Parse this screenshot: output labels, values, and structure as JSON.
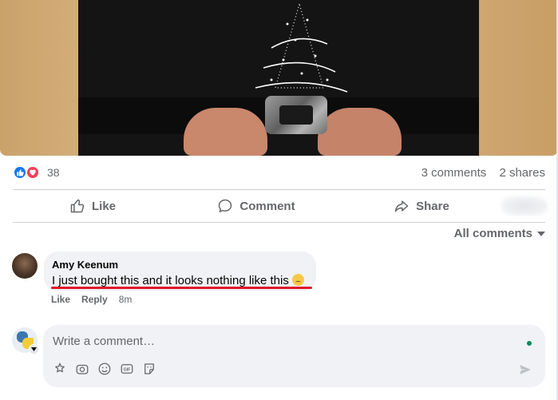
{
  "post": {
    "reaction_count": "38",
    "comments_count": "3 comments",
    "shares_count": "2 shares"
  },
  "actions": {
    "like": "Like",
    "comment": "Comment",
    "share": "Share"
  },
  "filter": {
    "label": "All comments"
  },
  "comments": [
    {
      "author": "Amy Keenum",
      "text": "I just bought this and it looks nothing like this",
      "emoji": "disappointed-face",
      "like_label": "Like",
      "reply_label": "Reply",
      "time": "8m"
    }
  ],
  "composer": {
    "placeholder": "Write a comment…"
  },
  "colors": {
    "accent": "#1877f2",
    "love": "#f33e58",
    "underline": "#e0192b",
    "online": "#0a8a5c"
  }
}
